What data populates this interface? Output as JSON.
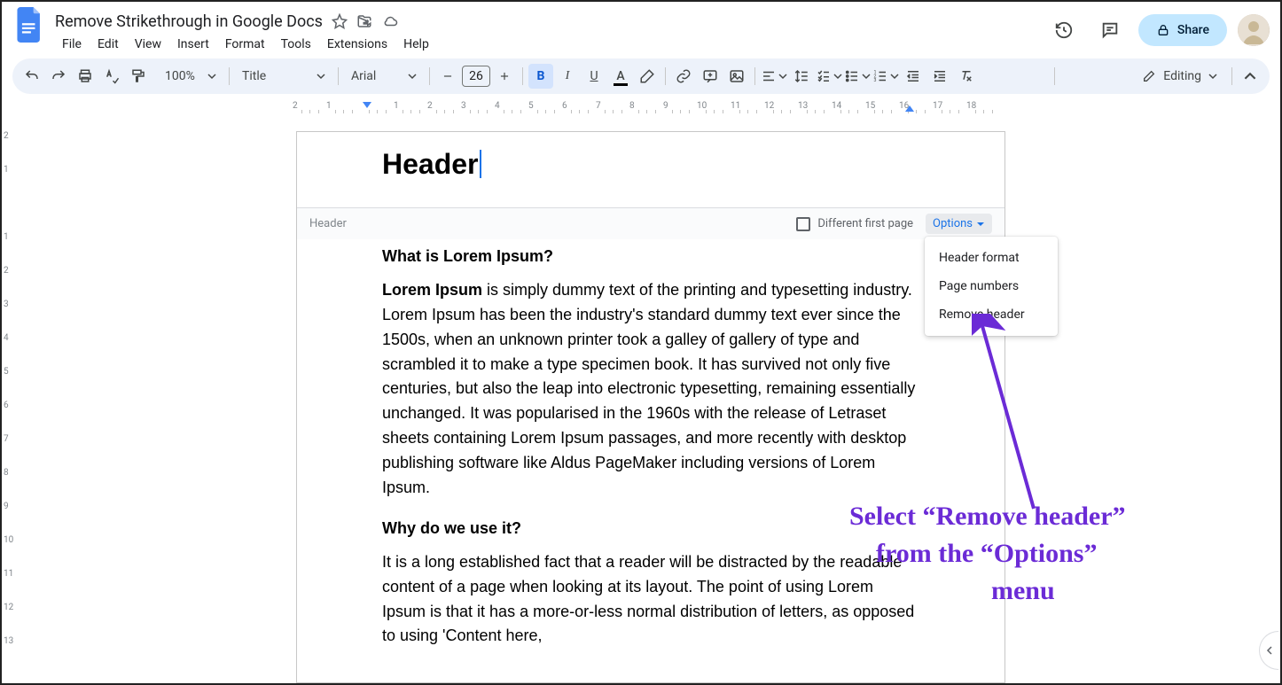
{
  "doc_title": "Remove Strikethrough in Google Docs",
  "menus": [
    "File",
    "Edit",
    "View",
    "Insert",
    "Format",
    "Tools",
    "Extensions",
    "Help"
  ],
  "share_label": "Share",
  "toolbar": {
    "zoom": "100%",
    "style": "Title",
    "font": "Arial",
    "font_size": "26",
    "editing_label": "Editing"
  },
  "header": {
    "title": "Header",
    "bar_label": "Header",
    "diff_first_label": "Different first page",
    "options_label": "Options"
  },
  "options_menu": [
    "Header format",
    "Page numbers",
    "Remove header"
  ],
  "body": {
    "h1": "What is Lorem Ipsum?",
    "p1_bold": "Lorem Ipsum",
    "p1_rest": " is simply dummy text of the printing and typesetting industry. Lorem Ipsum has been the industry's standard dummy text ever since the 1500s, when an unknown printer took a galley of gallery of type and scrambled it to make a type specimen book. It has survived not only five centuries, but also the leap into electronic typesetting, remaining essentially unchanged. It was popularised in the 1960s with the release of Letraset sheets containing Lorem Ipsum passages, and more recently with desktop publishing software like Aldus PageMaker including versions of Lorem Ipsum.",
    "h2": "Why do we use it?",
    "p2": "It is a long established fact that a reader will be distracted by the readable content of a page when looking at its layout. The point of using Lorem Ipsum is that it has a more-or-less normal distribution of letters, as opposed to using 'Content here,"
  },
  "annotation": {
    "l1": "Select “Remove header”",
    "l2": "from the “Options”",
    "l3": "menu"
  },
  "ruler_h": [
    2,
    1,
    "",
    1,
    2,
    3,
    4,
    5,
    6,
    7,
    8,
    9,
    10,
    11,
    12,
    13,
    14,
    15,
    16,
    17,
    18
  ],
  "ruler_v": [
    2,
    1,
    "",
    1,
    2,
    3,
    4,
    5,
    6,
    7,
    8,
    9,
    10,
    11,
    12,
    13
  ]
}
